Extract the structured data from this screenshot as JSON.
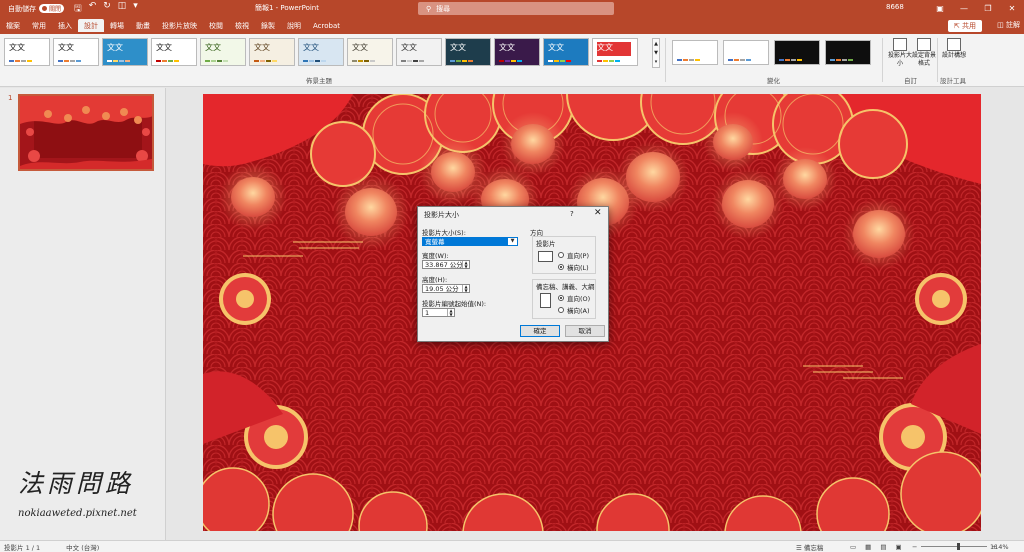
{
  "titlebar": {
    "autosave_label": "自動儲存",
    "autosave_state": "關閉",
    "doc_title": "簡報1 - PowerPoint",
    "search_placeholder": "搜尋",
    "user": "8668",
    "min": "—",
    "restore": "❐",
    "close": "✕"
  },
  "tabs": [
    "檔案",
    "常用",
    "插入",
    "設計",
    "轉場",
    "動畫",
    "投影片放映",
    "校閱",
    "檢視",
    "錄製",
    "說明",
    "Acrobat"
  ],
  "active_tab": "設計",
  "share_label": "共用",
  "comment_label": "註解",
  "ribbon": {
    "themes_group": "佈景主題",
    "variants_group": "變化",
    "customize_group": "自訂",
    "designer_group": "設計工具",
    "theme_sample_text": "文文",
    "slide_size_btn": "投影片大小",
    "format_bg_btn": "設定背景格式",
    "design_ideas_btn": "設計構想",
    "themes": [
      {
        "bg": "#ffffff",
        "fg": "#222222",
        "bars": [
          "#4472c4",
          "#ed7d31",
          "#a5a5a5",
          "#ffc000"
        ]
      },
      {
        "bg": "#ffffff",
        "fg": "#222222",
        "bars": [
          "#4472c4",
          "#ed7d31",
          "#a5a5a5",
          "#5b9bd5"
        ]
      },
      {
        "bg": "#2e8fc9",
        "fg": "#ffffff",
        "bars": [
          "#ffffff",
          "#ffd966",
          "#9dc3e6",
          "#f4b183"
        ]
      },
      {
        "bg": "#ffffff",
        "fg": "#222222",
        "bars": [
          "#c00000",
          "#ed7d31",
          "#70ad47",
          "#ffc000"
        ]
      },
      {
        "bg": "#f2f8e8",
        "fg": "#2d5a10",
        "bars": [
          "#70ad47",
          "#a9d18e",
          "#548235",
          "#c5e0b4"
        ]
      },
      {
        "bg": "#f5efe2",
        "fg": "#5a3d1a",
        "bars": [
          "#c55a11",
          "#f4b183",
          "#7f6000",
          "#ffd966"
        ]
      },
      {
        "bg": "#d8e6f2",
        "fg": "#1f4e79",
        "bars": [
          "#2e75b6",
          "#9dc3e6",
          "#1f4e79",
          "#bdd7ee"
        ]
      },
      {
        "bg": "#f7f4ea",
        "fg": "#403c30",
        "bars": [
          "#8f8a6e",
          "#bf9000",
          "#7f6000",
          "#c9c9c9"
        ]
      },
      {
        "bg": "#f2f2f2",
        "fg": "#333333",
        "bars": [
          "#7f7f7f",
          "#c9c9c9",
          "#404040",
          "#a6a6a6"
        ]
      },
      {
        "bg": "#1e3d4c",
        "fg": "#ffffff",
        "bars": [
          "#5b9bd5",
          "#70ad47",
          "#ffc000",
          "#ed7d31"
        ]
      },
      {
        "bg": "#3a1a4a",
        "fg": "#ffffff",
        "bars": [
          "#c00000",
          "#7030a0",
          "#ffc000",
          "#00b0f0"
        ]
      },
      {
        "bg": "#1d7bbf",
        "fg": "#ffffff",
        "bars": [
          "#ffffff",
          "#ffc000",
          "#92d050",
          "#ff0000"
        ]
      },
      {
        "bg": "#ffffff",
        "fg": "#ffffff",
        "bars": [
          "#e23535",
          "#ffc000",
          "#92d050",
          "#00b0f0"
        ]
      }
    ],
    "variants": [
      {
        "bg": "#ffffff",
        "bars": [
          "#4472c4",
          "#ed7d31",
          "#a5a5a5",
          "#ffc000"
        ]
      },
      {
        "bg": "#ffffff",
        "bars": [
          "#4472c4",
          "#ed7d31",
          "#a5a5a5",
          "#5b9bd5"
        ]
      },
      {
        "bg": "#0e0e0e",
        "bars": [
          "#4472c4",
          "#ed7d31",
          "#a5a5a5",
          "#ffc000"
        ]
      },
      {
        "bg": "#0e0e0e",
        "bars": [
          "#5b9bd5",
          "#ed7d31",
          "#a5a5a5",
          "#70ad47"
        ]
      }
    ]
  },
  "slide_panel": {
    "slide_number": "1"
  },
  "dialog": {
    "title": "投影片大小",
    "help": "?",
    "close": "✕",
    "size_for_label": "投影片大小(S):",
    "size_for_value": "寬螢幕",
    "width_label": "寬度(W):",
    "width_value": "33.867 公分",
    "height_label": "高度(H):",
    "height_value": "19.05 公分",
    "number_from_label": "投影片編號起始值(N):",
    "number_from_value": "1",
    "orientation_label": "方向",
    "slides_label": "投影片",
    "portrait_label": "直向(P)",
    "landscape_label": "橫向(L)",
    "notes_label": "備忘稿、講義、大綱",
    "notes_portrait_label": "直向(O)",
    "notes_landscape_label": "橫向(A)",
    "slides_orientation": "landscape",
    "notes_orientation": "portrait",
    "ok": "確定",
    "cancel": "取消"
  },
  "statusbar": {
    "slide_info": "投影片 1 / 1",
    "language": "中文 (台灣)",
    "notes": "備忘稿",
    "zoom": "114%",
    "views": [
      "▭",
      "▦",
      "▤",
      "▣"
    ],
    "zoom_minus": "−",
    "zoom_plus": "+"
  },
  "watermark": {
    "chinese": "法雨問路",
    "url": "nokiaaweted.pixnet.net"
  }
}
